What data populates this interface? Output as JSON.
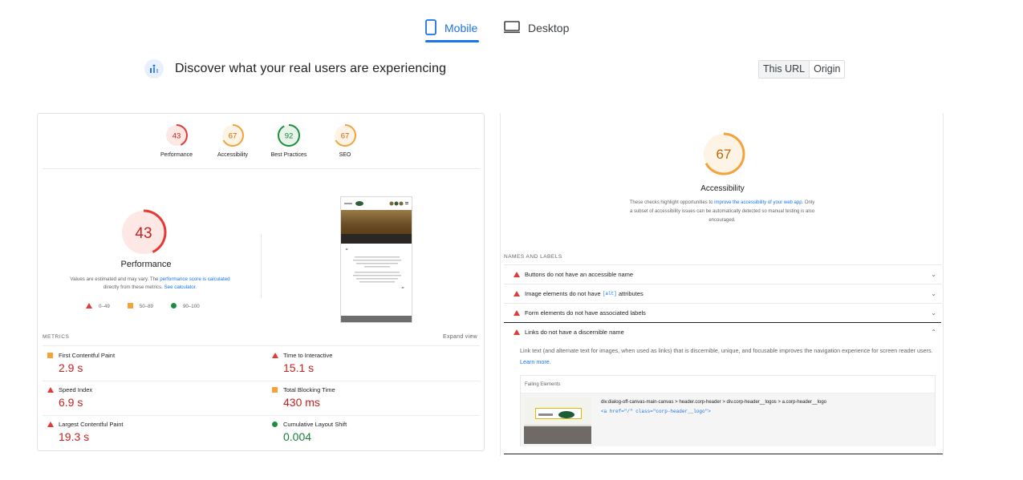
{
  "tabs": {
    "mobile": "Mobile",
    "desktop": "Desktop"
  },
  "discover": {
    "title": "Discover what your real users are experiencing",
    "toggle_this_url": "This URL",
    "toggle_origin": "Origin"
  },
  "summary_gauges": [
    {
      "score": "43",
      "label": "Performance",
      "color": "#e53935",
      "fraction": 0.43
    },
    {
      "score": "67",
      "label": "Accessibility",
      "color": "#f2a33a",
      "fraction": 0.67
    },
    {
      "score": "92",
      "label": "Best Practices",
      "color": "#1e8e3e",
      "fraction": 0.92
    },
    {
      "score": "67",
      "label": "SEO",
      "color": "#f2a33a",
      "fraction": 0.67
    }
  ],
  "performance": {
    "score": "43",
    "fraction": 0.43,
    "title": "Performance",
    "desc_prefix": "Values are estimated and may vary. The",
    "desc_link1": "performance score is calculated",
    "desc_middle": "directly from these metrics.",
    "desc_link2": "See calculator.",
    "legend": [
      {
        "range": "0–49",
        "shape": "triangle",
        "color": "#e53935"
      },
      {
        "range": "50–89",
        "shape": "square",
        "color": "#f2a33a"
      },
      {
        "range": "90–100",
        "shape": "circle",
        "color": "#1e8e3e"
      }
    ]
  },
  "metrics": {
    "header": "METRICS",
    "expand": "Expand view",
    "items": [
      {
        "name": "First Contentful Paint",
        "value": "2.9 s",
        "status": "average"
      },
      {
        "name": "Time to Interactive",
        "value": "15.1 s",
        "status": "fail"
      },
      {
        "name": "Speed Index",
        "value": "6.9 s",
        "status": "fail"
      },
      {
        "name": "Total Blocking Time",
        "value": "430 ms",
        "status": "average"
      },
      {
        "name": "Largest Contentful Paint",
        "value": "19.3 s",
        "status": "fail"
      },
      {
        "name": "Cumulative Layout Shift",
        "value": "0.004",
        "status": "pass"
      }
    ]
  },
  "accessibility": {
    "score": "67",
    "fraction": 0.67,
    "title": "Accessibility",
    "desc_prefix": "These checks highlight opportunities to",
    "desc_link": "improve the accessibility of your web app.",
    "desc_suffix": "Only a subset of accessibility issues can be automatically detected so manual testing is also encouraged.",
    "section": "NAMES AND LABELS",
    "audits": [
      {
        "text": "Buttons do not have an accessible name"
      },
      {
        "text_before": "Image elements do not have",
        "code": "[alt]",
        "text_after": "attributes"
      },
      {
        "text": "Form elements do not have associated labels"
      },
      {
        "text": "Links do not have a discernible name"
      }
    ],
    "open_desc": "Link text (and alternate text for images, when used as links) that is discernible, unique, and focusable improves the navigation experience for screen reader users.",
    "open_link": "Learn more.",
    "failing_header": "Failing Elements",
    "failing_selector": "div.dialog-off-canvas-main-canvas > header.corp-header > div.corp-header__logos > a.corp-header__logo",
    "failing_snippet": "<a href=\"/\" class=\"corp-header__logo\">"
  }
}
